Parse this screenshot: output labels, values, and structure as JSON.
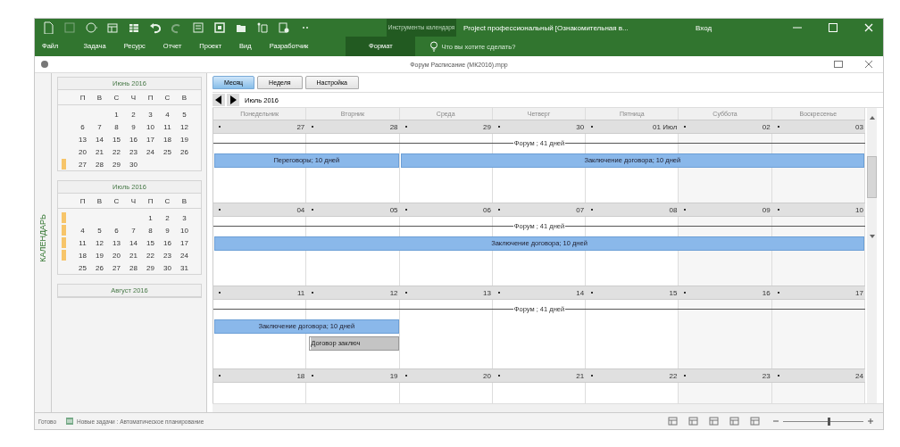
{
  "window": {
    "context_group": "Инструменты календаря",
    "title": "Project профессиональный [Ознакомительная в...",
    "sign_in": "Вход"
  },
  "ribbon_tabs": [
    {
      "label": "Файл",
      "selected": false,
      "contextual": false
    },
    {
      "label": "Задача",
      "selected": false,
      "contextual": false
    },
    {
      "label": "Ресурс",
      "selected": false,
      "contextual": false
    },
    {
      "label": "Отчет",
      "selected": false,
      "contextual": false
    },
    {
      "label": "Проект",
      "selected": false,
      "contextual": false
    },
    {
      "label": "Вид",
      "selected": false,
      "contextual": false
    },
    {
      "label": "Разработчик",
      "selected": false,
      "contextual": false
    },
    {
      "label": "Формат",
      "selected": false,
      "contextual": true
    }
  ],
  "tell_me": {
    "placeholder": "Что вы хотите сделать?"
  },
  "document": {
    "title": "Форум Расписание (МК2016).mpp"
  },
  "sidebar": {
    "label": "КАЛЕНДАРЬ"
  },
  "mini_calendars": [
    {
      "title": "Июнь 2016",
      "weekdays": [
        "П",
        "В",
        "С",
        "Ч",
        "П",
        "С",
        "В"
      ],
      "weeks": [
        {
          "dates": [
            "1",
            "2",
            "3",
            "4",
            "5"
          ],
          "marked": false
        },
        {
          "dates": [
            "6",
            "7",
            "8",
            "9",
            "10",
            "11",
            "12"
          ],
          "marked": false
        },
        {
          "dates": [
            "13",
            "14",
            "15",
            "16",
            "17",
            "18",
            "19"
          ],
          "marked": false
        },
        {
          "dates": [
            "20",
            "21",
            "22",
            "23",
            "24",
            "25",
            "26"
          ],
          "marked": false
        },
        {
          "dates": [
            "27",
            "28",
            "29",
            "30"
          ],
          "marked": true
        }
      ]
    },
    {
      "title": "Июль 2016",
      "weekdays": [
        "П",
        "В",
        "С",
        "Ч",
        "П",
        "С",
        "В"
      ],
      "weeks": [
        {
          "dates": [
            "1",
            "2",
            "3"
          ],
          "marked": true
        },
        {
          "dates": [
            "4",
            "5",
            "6",
            "7",
            "8",
            "9",
            "10"
          ],
          "marked": true
        },
        {
          "dates": [
            "11",
            "12",
            "13",
            "14",
            "15",
            "16",
            "17"
          ],
          "marked": true
        },
        {
          "dates": [
            "18",
            "19",
            "20",
            "21",
            "22",
            "23",
            "24"
          ],
          "marked": true
        },
        {
          "dates": [
            "25",
            "26",
            "27",
            "28",
            "29",
            "30",
            "31"
          ],
          "marked": false
        }
      ]
    },
    {
      "title": "Август 2016"
    }
  ],
  "view_buttons": [
    {
      "label": "Месяц",
      "selected": true
    },
    {
      "label": "Неделя",
      "selected": false
    },
    {
      "label": "Настройка",
      "selected": false
    }
  ],
  "period": {
    "label": "Июль 2016"
  },
  "day_headers": [
    "Понедельник",
    "Вторник",
    "Среда",
    "Четверг",
    "Пятница",
    "Суббота",
    "Воскресенье"
  ],
  "weeks": [
    {
      "dates": [
        "27",
        "28",
        "29",
        "30",
        "01 Июл",
        "02",
        "03"
      ],
      "bars": [
        {
          "kind": "summary",
          "label": "Форум ; 41 дней"
        },
        {
          "kind": "task",
          "label": "Переговоры; 10 дней",
          "on_days": [
            true,
            true,
            false,
            false,
            false,
            false,
            false
          ]
        },
        {
          "kind": "task",
          "label": "Заключение договора; 10 дней",
          "on_days": [
            false,
            false,
            true,
            true,
            true,
            true,
            true
          ]
        }
      ]
    },
    {
      "dates": [
        "04",
        "05",
        "06",
        "07",
        "08",
        "09",
        "10"
      ],
      "bars": [
        {
          "kind": "summary",
          "label": "Форум ; 41 дней"
        },
        {
          "kind": "task",
          "label": "Заключение договора; 10 дней",
          "on_days": [
            true,
            true,
            true,
            true,
            true,
            true,
            true
          ]
        }
      ]
    },
    {
      "dates": [
        "11",
        "12",
        "13",
        "14",
        "15",
        "16",
        "17"
      ],
      "bars": [
        {
          "kind": "summary",
          "label": "Форум ; 41 дней"
        },
        {
          "kind": "task",
          "label": "Заключение договора; 10 дней",
          "on_days": [
            true,
            true,
            false,
            false,
            false,
            false,
            false
          ]
        },
        {
          "kind": "milestone",
          "label": "Договор заключ",
          "on_days": [
            false,
            true,
            false,
            false,
            false,
            false,
            false
          ]
        }
      ]
    },
    {
      "dates": [
        "18",
        "19",
        "20",
        "21",
        "22",
        "23",
        "24"
      ]
    }
  ],
  "status_bar": {
    "ready": "Готово",
    "new_tasks": "Новые задачи : Автоматическое планирование",
    "zoom": {
      "level": 0.55
    }
  }
}
